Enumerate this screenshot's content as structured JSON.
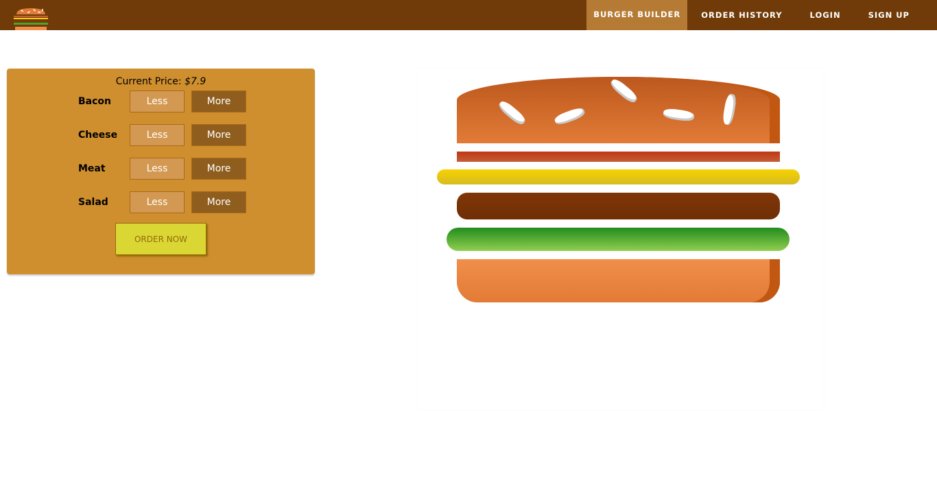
{
  "toolbar": {
    "logo_icon": "burger-logo-icon",
    "nav": [
      {
        "label": "BURGER BUILDER",
        "active": true
      },
      {
        "label": "ORDER HISTORY",
        "active": false
      },
      {
        "label": "LOGIN",
        "active": false
      },
      {
        "label": "SIGN UP",
        "active": false
      }
    ]
  },
  "build_controls": {
    "price_label": "Current Price:",
    "price_value": "$7.9",
    "controls": [
      {
        "label": "Bacon",
        "less": "Less",
        "more": "More"
      },
      {
        "label": "Cheese",
        "less": "Less",
        "more": "More"
      },
      {
        "label": "Meat",
        "less": "Less",
        "more": "More"
      },
      {
        "label": "Salad",
        "less": "Less",
        "more": "More"
      }
    ],
    "order_button": "ORDER NOW"
  },
  "burger": {
    "layers": [
      "bread-top",
      "bacon",
      "cheese",
      "meat",
      "salad",
      "bread-bottom"
    ]
  },
  "colors": {
    "toolbar": "#703B09",
    "nav_active": "#B57A33",
    "controls_bg": "#CF8F2E",
    "less_button": "#D39952",
    "more_button": "#8F5E1E",
    "order_button": "#DAD735"
  }
}
